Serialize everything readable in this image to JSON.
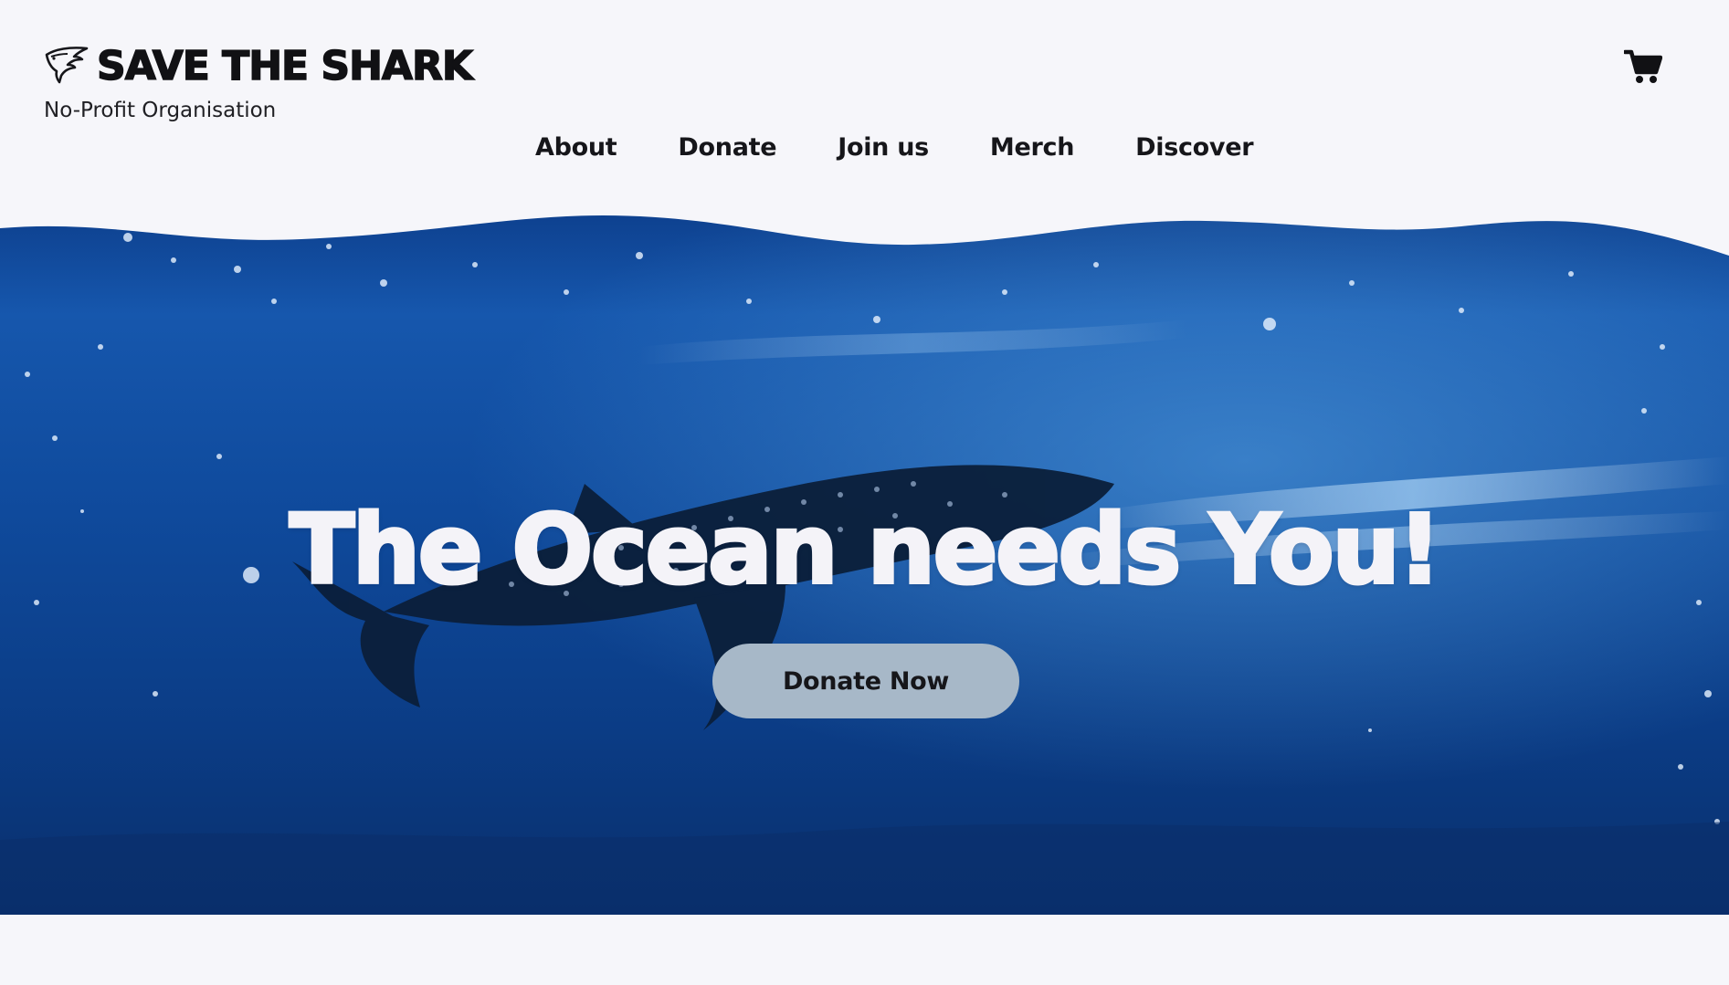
{
  "brand": {
    "title": "SAVE THE SHARK",
    "subtitle": "No-Profit Organisation",
    "logo_icon": "shark-logo-icon"
  },
  "header": {
    "cart_icon": "shopping-cart-icon"
  },
  "nav": {
    "items": [
      {
        "label": "About"
      },
      {
        "label": "Donate"
      },
      {
        "label": "Join us"
      },
      {
        "label": "Merch"
      },
      {
        "label": "Discover"
      }
    ]
  },
  "hero": {
    "heading": "The Ocean needs You!",
    "cta_label": "Donate Now",
    "image_subject": "whale shark swimming under the ocean surface"
  },
  "colors": {
    "background": "#f6f6fa",
    "text": "#111114",
    "ocean_dark": "#0a2b6a",
    "ocean_mid": "#0f4fa3",
    "ocean_light": "#2f7fd0",
    "button": "#a7b8c8",
    "heading": "#f4f3f8"
  }
}
